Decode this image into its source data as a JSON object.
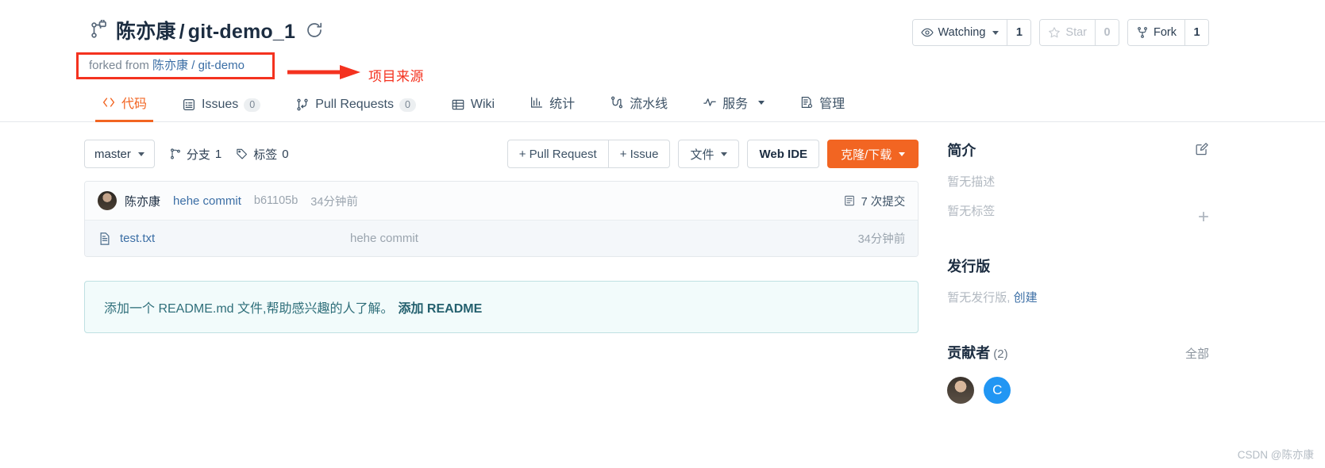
{
  "header": {
    "repo_icon": "repo-forked-lock-icon",
    "owner": "陈亦康",
    "separator": "/",
    "repo_name": "git-demo_1",
    "refresh_icon": "refresh-icon",
    "forked_prefix": "forked from",
    "forked_owner": "陈亦康",
    "forked_slash": "/",
    "forked_repo": "git-demo",
    "annotation_label": "项目来源",
    "annotation_color": "#f4321f"
  },
  "actions": {
    "watch_icon": "eye-icon",
    "watch_label": "Watching",
    "watch_count": "1",
    "star_icon": "star-icon",
    "star_label": "Star",
    "star_count": "0",
    "fork_icon": "fork-icon",
    "fork_label": "Fork",
    "fork_count": "1"
  },
  "tabs": [
    {
      "icon": "code-icon",
      "label": "代码",
      "badge": "",
      "active": true
    },
    {
      "icon": "issue-icon",
      "label": "Issues",
      "badge": "0",
      "active": false
    },
    {
      "icon": "pr-icon",
      "label": "Pull Requests",
      "badge": "0",
      "active": false
    },
    {
      "icon": "wiki-icon",
      "label": "Wiki",
      "badge": "",
      "active": false
    },
    {
      "icon": "chart-icon",
      "label": "统计",
      "badge": "",
      "active": false
    },
    {
      "icon": "pipeline-icon",
      "label": "流水线",
      "badge": "",
      "active": false
    },
    {
      "icon": "service-icon",
      "label": "服务",
      "badge": "",
      "active": false,
      "caret": true
    },
    {
      "icon": "manage-icon",
      "label": "管理",
      "badge": "",
      "active": false
    }
  ],
  "toolbar": {
    "branch_label": "master",
    "branches_icon": "branch-icon",
    "branches_label": "分支",
    "branches_count": "1",
    "tags_icon": "tag-icon",
    "tags_label": "标签",
    "tags_count": "0",
    "pull_request_label": "+ Pull Request",
    "issue_label": "+ Issue",
    "files_label": "文件",
    "web_ide_label": "Web IDE",
    "clone_label": "克隆/下载"
  },
  "commit": {
    "avatar": "user-avatar",
    "author": "陈亦康",
    "message": "hehe commit",
    "sha": "b61105b",
    "time": "34分钟前",
    "count_icon": "commits-icon",
    "count_label": "7 次提交"
  },
  "files": [
    {
      "icon": "file-icon",
      "name": "test.txt",
      "message": "hehe commit",
      "time": "34分钟前"
    }
  ],
  "readme": {
    "text": "添加一个 README.md 文件,帮助感兴趣的人了解。",
    "cta": "添加 README"
  },
  "sidebar": {
    "about_title": "简介",
    "about_edit_icon": "edit-icon",
    "no_description": "暂无描述",
    "no_tags": "暂无标签",
    "add_tag_icon": "plus-icon",
    "releases_title": "发行版",
    "no_releases": "暂无发行版,",
    "create_release": "创建",
    "contributors_title": "贡献者",
    "contributors_count": "(2)",
    "contributors_all": "全部",
    "contributors": [
      {
        "type": "photo",
        "label": ""
      },
      {
        "type": "letter",
        "label": "C"
      }
    ]
  },
  "watermark": "CSDN @陈亦康"
}
